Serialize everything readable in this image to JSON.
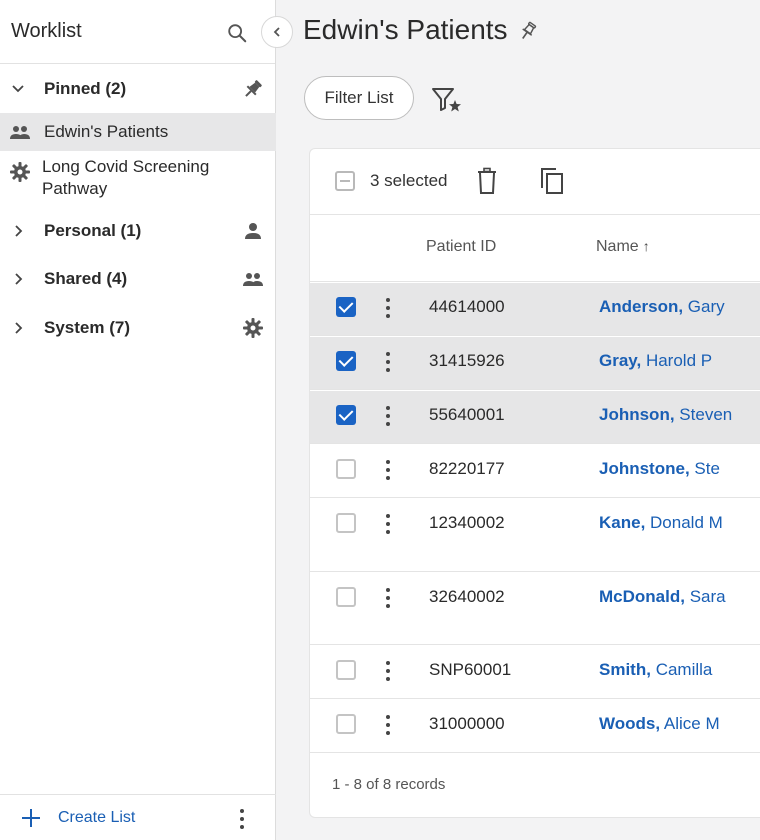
{
  "sidebar": {
    "title": "Worklist",
    "groups": [
      {
        "label": "Pinned (2)",
        "icon": "pin-icon",
        "expanded": true
      },
      {
        "label": "Personal (1)",
        "icon": "person-icon",
        "expanded": false
      },
      {
        "label": "Shared (4)",
        "icon": "people-icon",
        "expanded": false
      },
      {
        "label": "System (7)",
        "icon": "gear-icon",
        "expanded": false
      }
    ],
    "pinned_items": [
      {
        "label": "Edwin's Patients",
        "icon": "people-icon",
        "active": true
      },
      {
        "label": "Long Covid Screening Pathway",
        "icon": "gear-icon",
        "active": false
      }
    ],
    "create_label": "Create List"
  },
  "main": {
    "title": "Edwin's Patients",
    "filter_label": "Filter List",
    "selected_text": "3 selected",
    "columns": [
      "Patient ID",
      "Name"
    ],
    "sort_indicator": "↑",
    "rows": [
      {
        "id": "44614000",
        "surname": "Anderson,",
        "given": "Gary",
        "selected": true
      },
      {
        "id": "31415926",
        "surname": "Gray,",
        "given": "Harold P",
        "selected": true
      },
      {
        "id": "55640001",
        "surname": "Johnson,",
        "given": "Steven",
        "selected": true
      },
      {
        "id": "82220177",
        "surname": "Johnstone,",
        "given": "Ste",
        "selected": false
      },
      {
        "id": "12340002",
        "surname": "Kane,",
        "given": "Donald M",
        "selected": false
      },
      {
        "id": "32640002",
        "surname": "McDonald,",
        "given": "Sara",
        "selected": false
      },
      {
        "id": "SNP60001",
        "surname": "Smith,",
        "given": "Camilla",
        "selected": false
      },
      {
        "id": "31000000",
        "surname": "Woods,",
        "given": "Alice M",
        "selected": false
      }
    ],
    "records_text": "1 - 8 of 8 records"
  },
  "colors": {
    "accent": "#1a63c4",
    "link": "#1a5fb4",
    "selected_row": "#e6e6e7"
  }
}
